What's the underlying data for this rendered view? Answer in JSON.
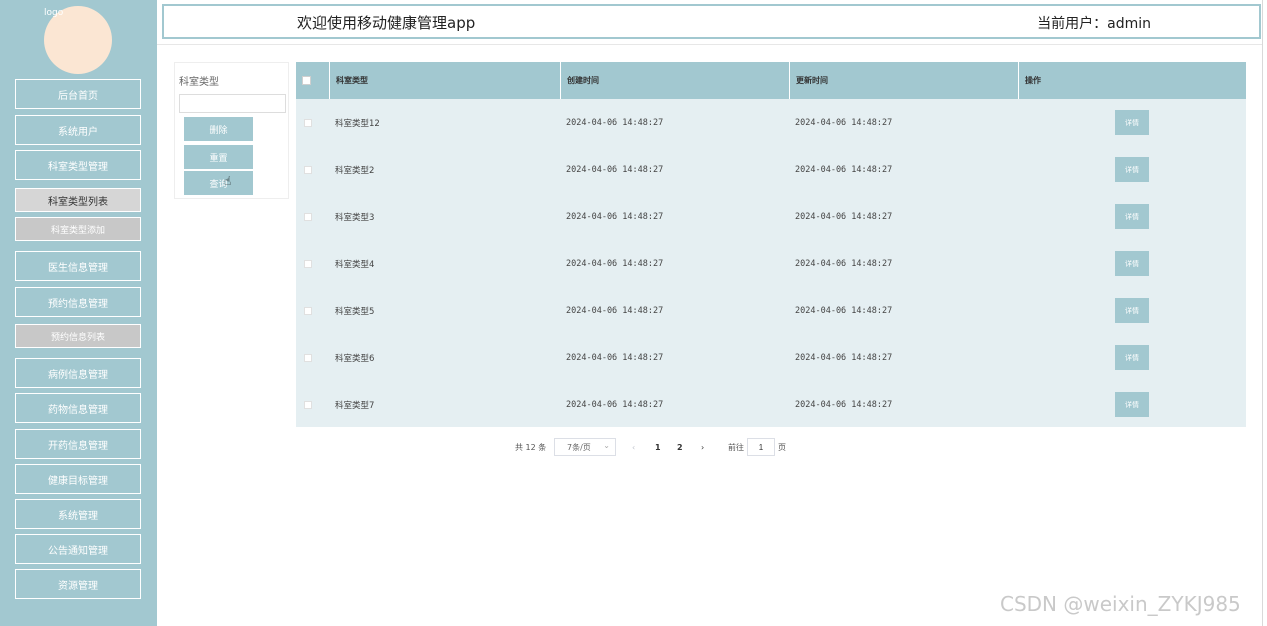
{
  "sidebar": {
    "logo_alt": "logo",
    "items": [
      {
        "label": "后台首页"
      },
      {
        "label": "系统用户"
      },
      {
        "label": "科室类型管理"
      },
      {
        "label": "科室类型列表"
      },
      {
        "label": "科室类型添加"
      },
      {
        "label": "医生信息管理"
      },
      {
        "label": "预约信息管理"
      },
      {
        "label": "预约信息列表"
      },
      {
        "label": "病例信息管理"
      },
      {
        "label": "药物信息管理"
      },
      {
        "label": "开药信息管理"
      },
      {
        "label": "健康目标管理"
      },
      {
        "label": "系统管理"
      },
      {
        "label": "公告通知管理"
      },
      {
        "label": "资源管理"
      }
    ]
  },
  "header": {
    "title": "欢迎使用移动健康管理app",
    "user": "当前用户：admin"
  },
  "filter": {
    "label": "科室类型",
    "input_value": "",
    "delete_label": "删除",
    "reset_label": "重置",
    "query_label": "查询"
  },
  "table": {
    "columns": [
      "科室类型",
      "创建时间",
      "更新时间",
      "操作"
    ],
    "rows": [
      {
        "name": "科室类型12",
        "created": "2024-04-06 14:48:27",
        "updated": "2024-04-06 14:48:27",
        "action": "详情"
      },
      {
        "name": "科室类型2",
        "created": "2024-04-06 14:48:27",
        "updated": "2024-04-06 14:48:27",
        "action": "详情"
      },
      {
        "name": "科室类型3",
        "created": "2024-04-06 14:48:27",
        "updated": "2024-04-06 14:48:27",
        "action": "详情"
      },
      {
        "name": "科室类型4",
        "created": "2024-04-06 14:48:27",
        "updated": "2024-04-06 14:48:27",
        "action": "详情"
      },
      {
        "name": "科室类型5",
        "created": "2024-04-06 14:48:27",
        "updated": "2024-04-06 14:48:27",
        "action": "详情"
      },
      {
        "name": "科室类型6",
        "created": "2024-04-06 14:48:27",
        "updated": "2024-04-06 14:48:27",
        "action": "详情"
      },
      {
        "name": "科室类型7",
        "created": "2024-04-06 14:48:27",
        "updated": "2024-04-06 14:48:27",
        "action": "详情"
      }
    ]
  },
  "pagination": {
    "total": "共 12 条",
    "page_size": "7条/页",
    "prev": "‹",
    "pages": [
      "1",
      "2"
    ],
    "next": "›",
    "goto_prefix": "前往",
    "goto_value": "1",
    "goto_suffix": "页"
  },
  "watermark": "CSDN @weixin_ZYKJ985",
  "colors": {
    "accent": "#a2c8d0",
    "table_body": "#e5eff2",
    "avatar": "#fbe6d3"
  }
}
